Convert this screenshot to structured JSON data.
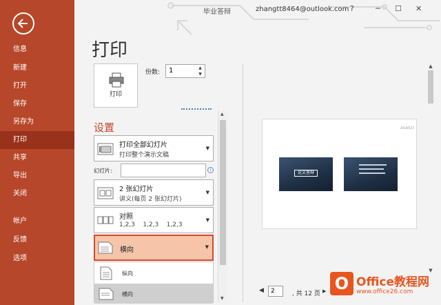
{
  "titlebar": {
    "doc_name": "毕业答辩",
    "user": "zhangtt8464@outlook.com",
    "help": "?",
    "minimize": "─",
    "restore": "☐",
    "close": "✕"
  },
  "sidebar": {
    "items": [
      "信息",
      "新建",
      "打开",
      "保存",
      "另存为",
      "打印",
      "共享",
      "导出",
      "关闭",
      "帐户",
      "反馈",
      "选项"
    ]
  },
  "page_title": "打印",
  "print_button": "打印",
  "copies": {
    "label": "份数:",
    "value": "1"
  },
  "settings_title": "设置",
  "print_range": {
    "title": "打印全部幻灯片",
    "subtitle": "打印整个演示文稿"
  },
  "slides": {
    "label": "幻灯片:",
    "value": ""
  },
  "layout": {
    "title": "2 张幻灯片",
    "subtitle": "讲义(每页 2 张幻灯片)"
  },
  "collate": {
    "title": "对照",
    "subtitle": "1,2,3    1,2,3    1,2,3"
  },
  "orientation": {
    "selected": "横向",
    "options": [
      "纵向",
      "横向"
    ]
  },
  "preview": {
    "date": "2019/5/17",
    "slide1_text": "论文答辩"
  },
  "pager": {
    "prev": "◀",
    "current": "2",
    "total": ", 共 12 页",
    "next": "▶"
  },
  "watermark": {
    "brand_o": "O",
    "brand_text": "Office教程网",
    "url": "www.office26.com"
  },
  "colors": {
    "sidebar": "#b7472a",
    "accent": "#c0472a",
    "highlight": "#f6c4a9",
    "highlight_border": "#d24a2e"
  }
}
